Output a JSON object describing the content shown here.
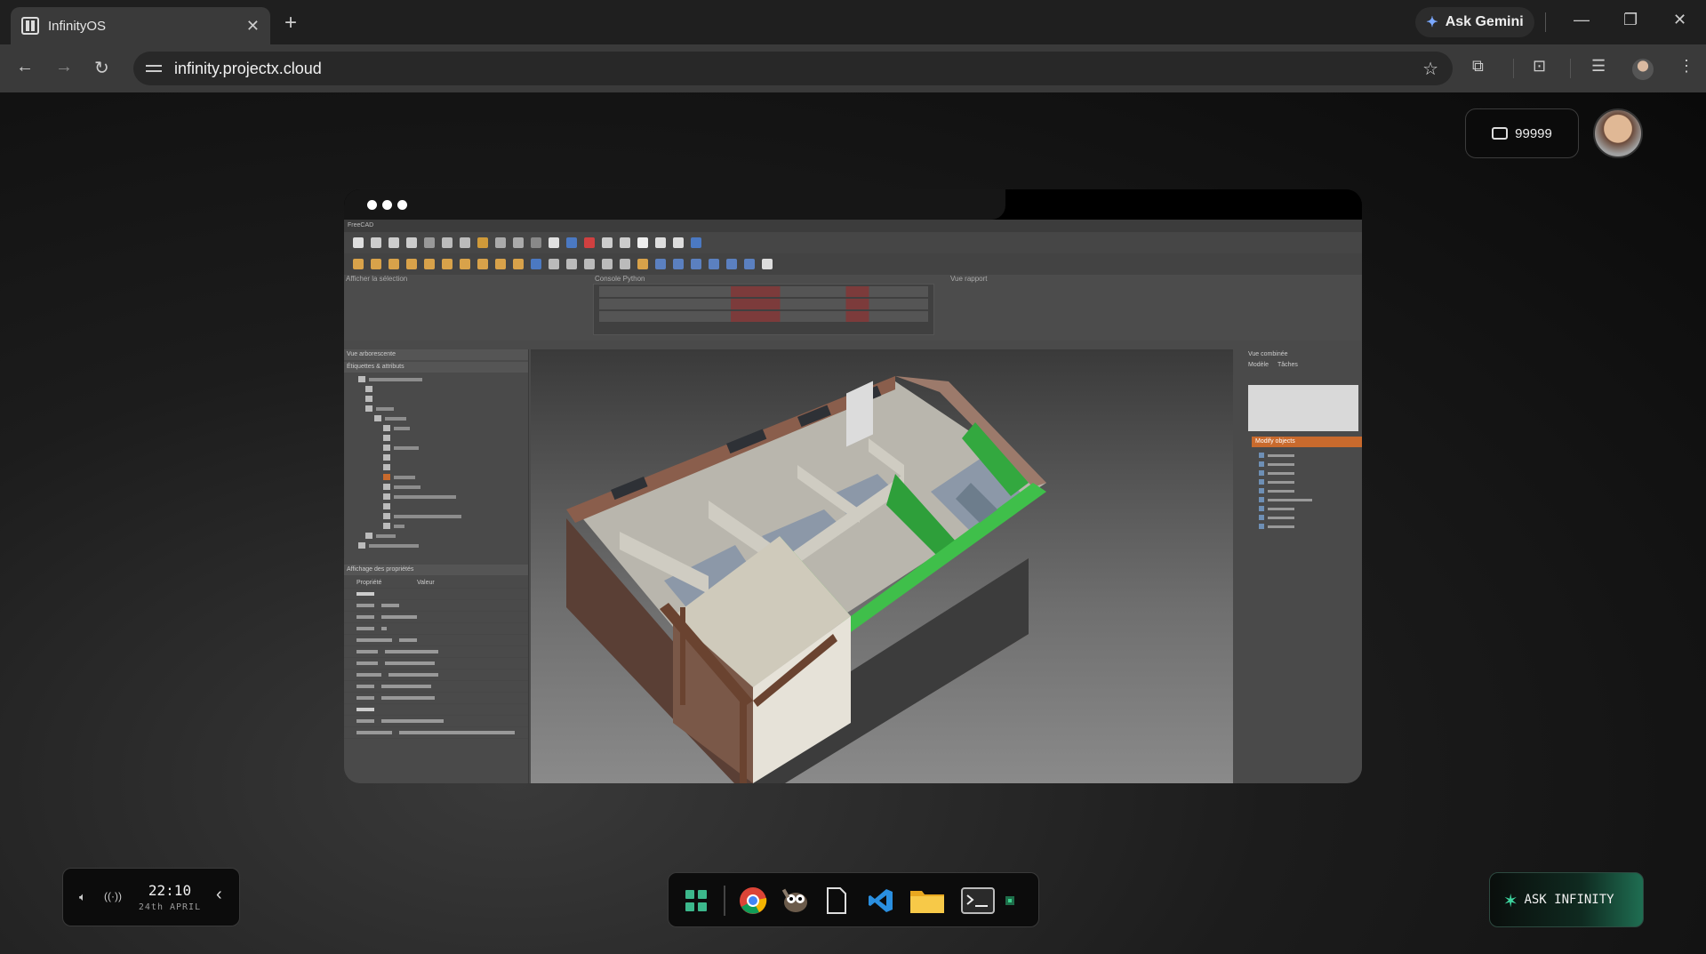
{
  "browser": {
    "tab_title": "InfinityOS",
    "tab_close": "✕",
    "new_tab": "+",
    "ask_gemini": "Ask Gemini",
    "url": "infinity.projectx.cloud",
    "window_controls": {
      "minimize": "—",
      "restore": "❐",
      "close": "✕"
    }
  },
  "desktop": {
    "credits": "99999",
    "app_window": {
      "app": "FreeCAD",
      "panels": {
        "selection": "Afficher la sélection",
        "python_console": "Console Python",
        "report": "Vue rapport",
        "tree": "Vue arborescente",
        "tree_sub": "Étiquettes & attributs",
        "properties": "Affichage des propriétés",
        "prop_headers": [
          "Propriété",
          "Valeur"
        ],
        "combo": "Vue combinée",
        "combo_tabs": [
          "Modèle",
          "Tâches"
        ],
        "modify": "Modify objects"
      }
    }
  },
  "taskbar": {
    "time": "22:10",
    "date": "24th APRIL",
    "ask_infinity": "ASK INFINITY",
    "dock_icons": [
      "apps-grid-icon",
      "chrome-icon",
      "gimp-icon",
      "file-icon",
      "vscode-icon",
      "folder-icon",
      "terminal-icon",
      "tray-icon"
    ]
  }
}
